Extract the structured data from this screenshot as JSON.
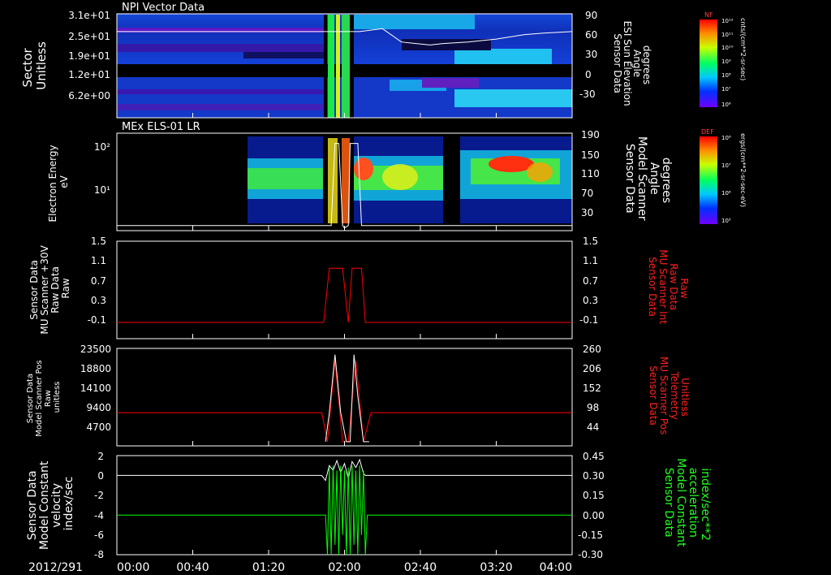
{
  "page": {
    "date_label": "2012/291"
  },
  "time_axis": {
    "ticks": [
      "00:00",
      "00:40",
      "01:20",
      "02:00",
      "02:40",
      "03:20",
      "04:00"
    ],
    "minutes": [
      0,
      40,
      80,
      120,
      160,
      200,
      240
    ],
    "range_minutes": [
      0,
      240
    ]
  },
  "colors": {
    "background": "#000000",
    "axis": "#ffffff",
    "trace_white": "#ffffff",
    "trace_red": "#ff0000",
    "trace_green": "#00ff00",
    "label_red": "#ff2020",
    "label_green": "#20ff20"
  },
  "chart_data": [
    {
      "type": "heatmap",
      "panel_title": "NPI Vector Data",
      "ylabel_left": [
        "Sector",
        "Unitless"
      ],
      "left_ticks": [
        "3.1e+01",
        "2.5e+01",
        "1.9e+01",
        "1.2e+01",
        "6.2e+00"
      ],
      "ylabel_right": [
        "Sensor Data",
        "ESI Sun Elevation",
        "Angle",
        "degrees"
      ],
      "right_ticks": [
        "90",
        "60",
        "30",
        "0",
        "-30"
      ],
      "right_ylim": [
        -50,
        90
      ],
      "overlay_line": {
        "color": "white",
        "x_minutes": [
          0,
          100,
          110,
          120,
          128,
          140,
          150,
          165,
          172,
          185,
          200,
          215,
          225,
          240
        ],
        "y_degrees": [
          66,
          66,
          66,
          66,
          66,
          70,
          52,
          48,
          50,
          52,
          56,
          62,
          64,
          66
        ]
      },
      "colorbar": {
        "label": "NF",
        "units": "cnts/(cm**2-sr-sec)",
        "ticks": [
          "10¹²",
          "10¹¹",
          "10¹⁰",
          "10⁹",
          "10⁸",
          "10⁷",
          "10⁶"
        ]
      }
    },
    {
      "type": "heatmap",
      "panel_title": "MEx ELS-01 LR",
      "ylabel_left": [
        "Electron Energy",
        "eV"
      ],
      "left_ticks": [
        "10²",
        "10¹"
      ],
      "ylabel_right": [
        "Sensor Data",
        "Model Scanner",
        "Angle",
        "degrees"
      ],
      "right_ticks": [
        "190",
        "150",
        "110",
        "70",
        "30"
      ],
      "right_ylim": [
        0,
        190
      ],
      "overlay_line": {
        "color": "white",
        "x_minutes": [
          0,
          110,
          112,
          113,
          115,
          117,
          119,
          120,
          122,
          123,
          125,
          127,
          129,
          130,
          132,
          134,
          240
        ],
        "y_degrees": [
          10,
          10,
          10,
          10,
          170,
          170,
          10,
          5,
          10,
          170,
          170,
          170,
          10,
          10,
          10,
          10,
          10
        ]
      },
      "colorbar": {
        "label": "DEF",
        "units": "ergs/(cm**2-sr-sec-eV)",
        "ticks": [
          "10⁸",
          "10⁷",
          "10⁶",
          "10⁵"
        ]
      }
    },
    {
      "type": "line",
      "ylabel_left": [
        "Sensor Data",
        "MU Scanner +30V",
        "Raw Data",
        "Raw"
      ],
      "left_ticks": [
        "1.5",
        "1.1",
        "0.7",
        "0.3",
        "-0.1"
      ],
      "ylim": [
        -0.3,
        1.5
      ],
      "ylabel_right": [
        "Sensor Data",
        "MU Scanner Int",
        "Raw Data",
        "Raw"
      ],
      "right_ticks": [
        "1.5",
        "1.1",
        "0.7",
        "0.3",
        "-0.1"
      ],
      "series": [
        {
          "color": "red",
          "x_minutes": [
            0,
            109,
            112,
            119,
            122,
            124,
            129,
            131,
            240
          ],
          "values": [
            0,
            0,
            1,
            1,
            0,
            1,
            1,
            0,
            0
          ]
        }
      ]
    },
    {
      "type": "line",
      "ylabel_left": [
        "Sensor Data",
        "Model Scanner Pos",
        "Raw",
        "unitless"
      ],
      "left_ticks": [
        "23500",
        "18800",
        "14100",
        "9400",
        "4700"
      ],
      "ylim": [
        0,
        23500
      ],
      "ylabel_right": [
        "Sensor Data",
        "MU Scanner Pos",
        "Telemetry",
        "Unitless"
      ],
      "right_ticks": [
        "260",
        "206",
        "152",
        "98",
        "44"
      ],
      "series": [
        {
          "color": "red",
          "x_minutes": [
            0,
            108,
            111,
            115,
            119,
            122,
            126,
            130,
            134,
            240
          ],
          "values": [
            8000,
            8000,
            1000,
            20500,
            1000,
            1000,
            20500,
            1000,
            8000,
            8000
          ]
        },
        {
          "color": "white",
          "x_minutes": [
            110,
            112,
            115,
            118,
            121,
            123,
            125,
            127,
            130,
            133
          ],
          "values": [
            1000,
            8000,
            22000,
            8000,
            1000,
            1000,
            22000,
            12000,
            1000,
            1000
          ]
        }
      ]
    },
    {
      "type": "line",
      "ylabel_left": [
        "Sensor Data",
        "Model Constant",
        "velocity",
        "index/sec"
      ],
      "left_ticks": [
        "2",
        "0",
        "-2",
        "-4",
        "-6",
        "-8"
      ],
      "ylim": [
        -8,
        2
      ],
      "ylabel_right": [
        "Sensor Data",
        "Model Constant",
        "acceleration",
        "index/sec**2"
      ],
      "right_ticks": [
        "0.45",
        "0.30",
        "0.15",
        "0.00",
        "-0.15",
        "-0.30"
      ],
      "series": [
        {
          "color": "white",
          "x_minutes": [
            0,
            108,
            110,
            112,
            114,
            116,
            118,
            120,
            122,
            124,
            126,
            128,
            130,
            131,
            132,
            240
          ],
          "values": [
            0,
            0,
            -0.5,
            1,
            0.5,
            1.5,
            0.3,
            1.2,
            -0.3,
            1.4,
            0.8,
            1.6,
            0.2,
            0,
            0,
            0
          ]
        },
        {
          "color": "green",
          "x_minutes": [
            0,
            110,
            111,
            112,
            113,
            114,
            115,
            116,
            117,
            118,
            119,
            120,
            121,
            122,
            123,
            124,
            125,
            126,
            127,
            128,
            129,
            130,
            131,
            132,
            133,
            240
          ],
          "values": [
            -4,
            -4,
            -8,
            0.8,
            -8,
            1,
            -7,
            0.5,
            -8,
            1,
            -6,
            0.5,
            -8,
            0.8,
            -8,
            1,
            -7,
            0.5,
            -8,
            1,
            -6,
            0.5,
            -8,
            -4,
            -4,
            -4
          ]
        }
      ]
    }
  ]
}
